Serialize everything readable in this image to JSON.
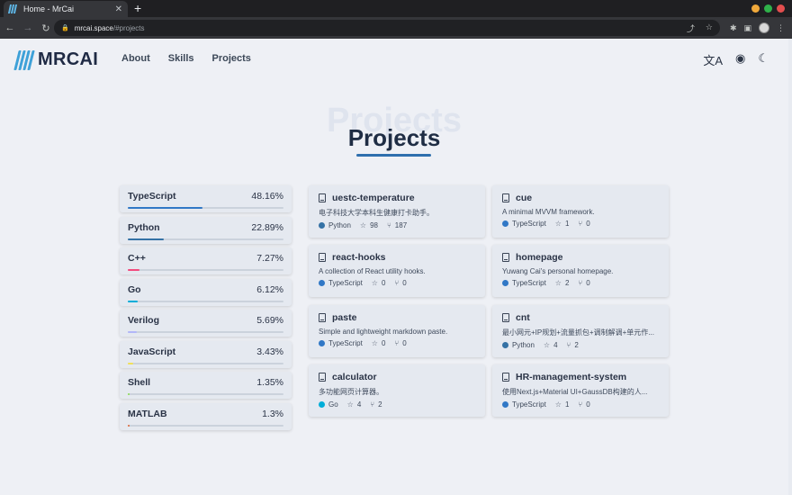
{
  "browser": {
    "tab_title": "Home - MrCai",
    "tab_close": "✕",
    "new_tab": "+",
    "url_host": "mrcai.space",
    "url_path": "/#projects",
    "icons": [
      "back-icon",
      "forward-icon",
      "reload-icon",
      "lock-icon",
      "share-icon",
      "star-icon",
      "extensions-icon",
      "sidepanel-icon",
      "profile-icon",
      "menu-icon"
    ],
    "window_colors": [
      "#f1a93b",
      "#2fb24a",
      "#e34e4e"
    ]
  },
  "site": {
    "brand": "MRCAI",
    "brand_color": "#3ea1d8",
    "nav": [
      "About",
      "Skills",
      "Projects"
    ],
    "header_icons": [
      "translate-icon",
      "github-icon",
      "moon-icon"
    ]
  },
  "section": {
    "ghost_title": "Projects",
    "title": "Projects",
    "accent": "#2f6fae"
  },
  "languages": [
    {
      "name": "TypeScript",
      "percent": "48.16%",
      "fill": 0.4816,
      "color": "#3178c6"
    },
    {
      "name": "Python",
      "percent": "22.89%",
      "fill": 0.2289,
      "color": "#3572a5"
    },
    {
      "name": "C++",
      "percent": "7.27%",
      "fill": 0.0727,
      "color": "#f34b7d"
    },
    {
      "name": "Go",
      "percent": "6.12%",
      "fill": 0.0612,
      "color": "#00add8"
    },
    {
      "name": "Verilog",
      "percent": "5.69%",
      "fill": 0.0569,
      "color": "#b2b7f8"
    },
    {
      "name": "JavaScript",
      "percent": "3.43%",
      "fill": 0.0343,
      "color": "#f1e05a"
    },
    {
      "name": "Shell",
      "percent": "1.35%",
      "fill": 0.0135,
      "color": "#89e051"
    },
    {
      "name": "MATLAB",
      "percent": "1.3%",
      "fill": 0.013,
      "color": "#e16737"
    }
  ],
  "repos": [
    {
      "name": "uestc-temperature",
      "desc": "电子科技大学本科生健康打卡助手。",
      "lang": "Python",
      "lang_color": "#3572a5",
      "stars": "98",
      "forks": "187"
    },
    {
      "name": "cue",
      "desc": "A minimal MVVM framework.",
      "lang": "TypeScript",
      "lang_color": "#3178c6",
      "stars": "1",
      "forks": "0"
    },
    {
      "name": "react-hooks",
      "desc": "A collection of React utility hooks.",
      "lang": "TypeScript",
      "lang_color": "#3178c6",
      "stars": "0",
      "forks": "0"
    },
    {
      "name": "homepage",
      "desc": "Yuwang Cai's personal homepage.",
      "lang": "TypeScript",
      "lang_color": "#3178c6",
      "stars": "2",
      "forks": "0"
    },
    {
      "name": "paste",
      "desc": "Simple and lightweight markdown paste.",
      "lang": "TypeScript",
      "lang_color": "#3178c6",
      "stars": "0",
      "forks": "0"
    },
    {
      "name": "cnt",
      "desc": "最小网元+IP规划+流量抓包+调制解调+单元作...",
      "lang": "Python",
      "lang_color": "#3572a5",
      "stars": "4",
      "forks": "2"
    },
    {
      "name": "calculator",
      "desc": "多功能网页计算器。",
      "lang": "Go",
      "lang_color": "#00add8",
      "stars": "4",
      "forks": "2"
    },
    {
      "name": "HR-management-system",
      "desc": "使用Next.js+Material UI+GaussDB构建的人...",
      "lang": "TypeScript",
      "lang_color": "#3178c6",
      "stars": "1",
      "forks": "0"
    }
  ]
}
